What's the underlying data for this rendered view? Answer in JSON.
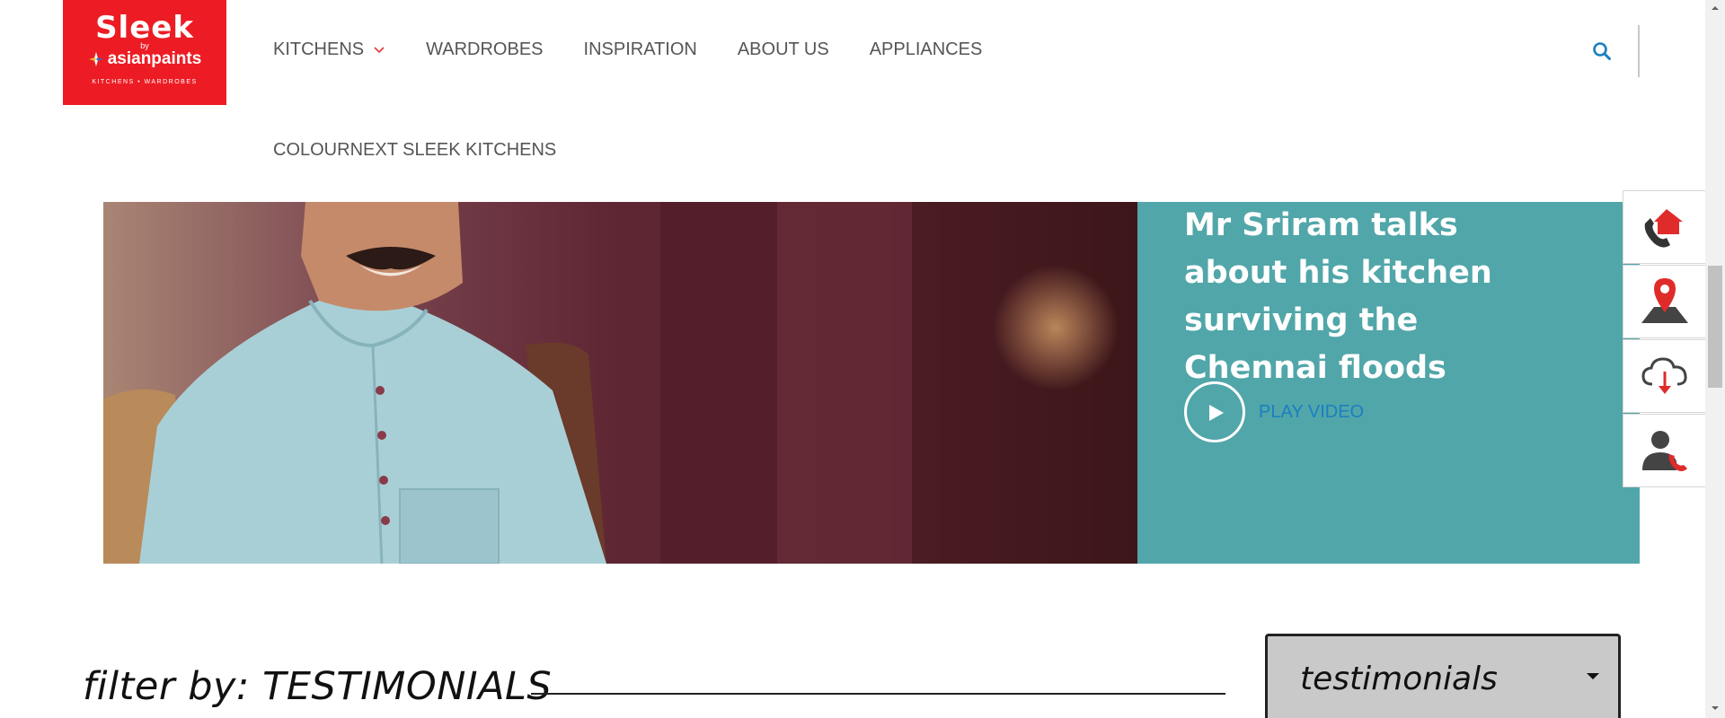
{
  "logo": {
    "brand": "Sleek",
    "by": "by",
    "parent": "asianpaints",
    "tagline": "KITCHENS • WARDROBES"
  },
  "nav": {
    "items": [
      {
        "label": "KITCHENS",
        "has_dropdown": true
      },
      {
        "label": "WARDROBES"
      },
      {
        "label": "INSPIRATION"
      },
      {
        "label": "ABOUT US"
      },
      {
        "label": "APPLIANCES"
      }
    ],
    "row2": "COLOURNEXT SLEEK KITCHENS"
  },
  "icons": {
    "search": "search-icon",
    "chevron": "chevron-down-icon",
    "side": [
      "phone-home-icon",
      "location-pin-icon",
      "cloud-download-icon",
      "contact-callback-icon"
    ]
  },
  "hero": {
    "title": "Mr Sriram talks about his kitchen surviving the Chennai floods",
    "play_label": "PLAY VIDEO"
  },
  "filter": {
    "label": "filter by: TESTIMONIALS",
    "selected": "testimonials"
  },
  "colors": {
    "brand_red": "#ed1c24",
    "panel_teal": "#51a6a9",
    "link_blue": "#1a7fc1"
  }
}
